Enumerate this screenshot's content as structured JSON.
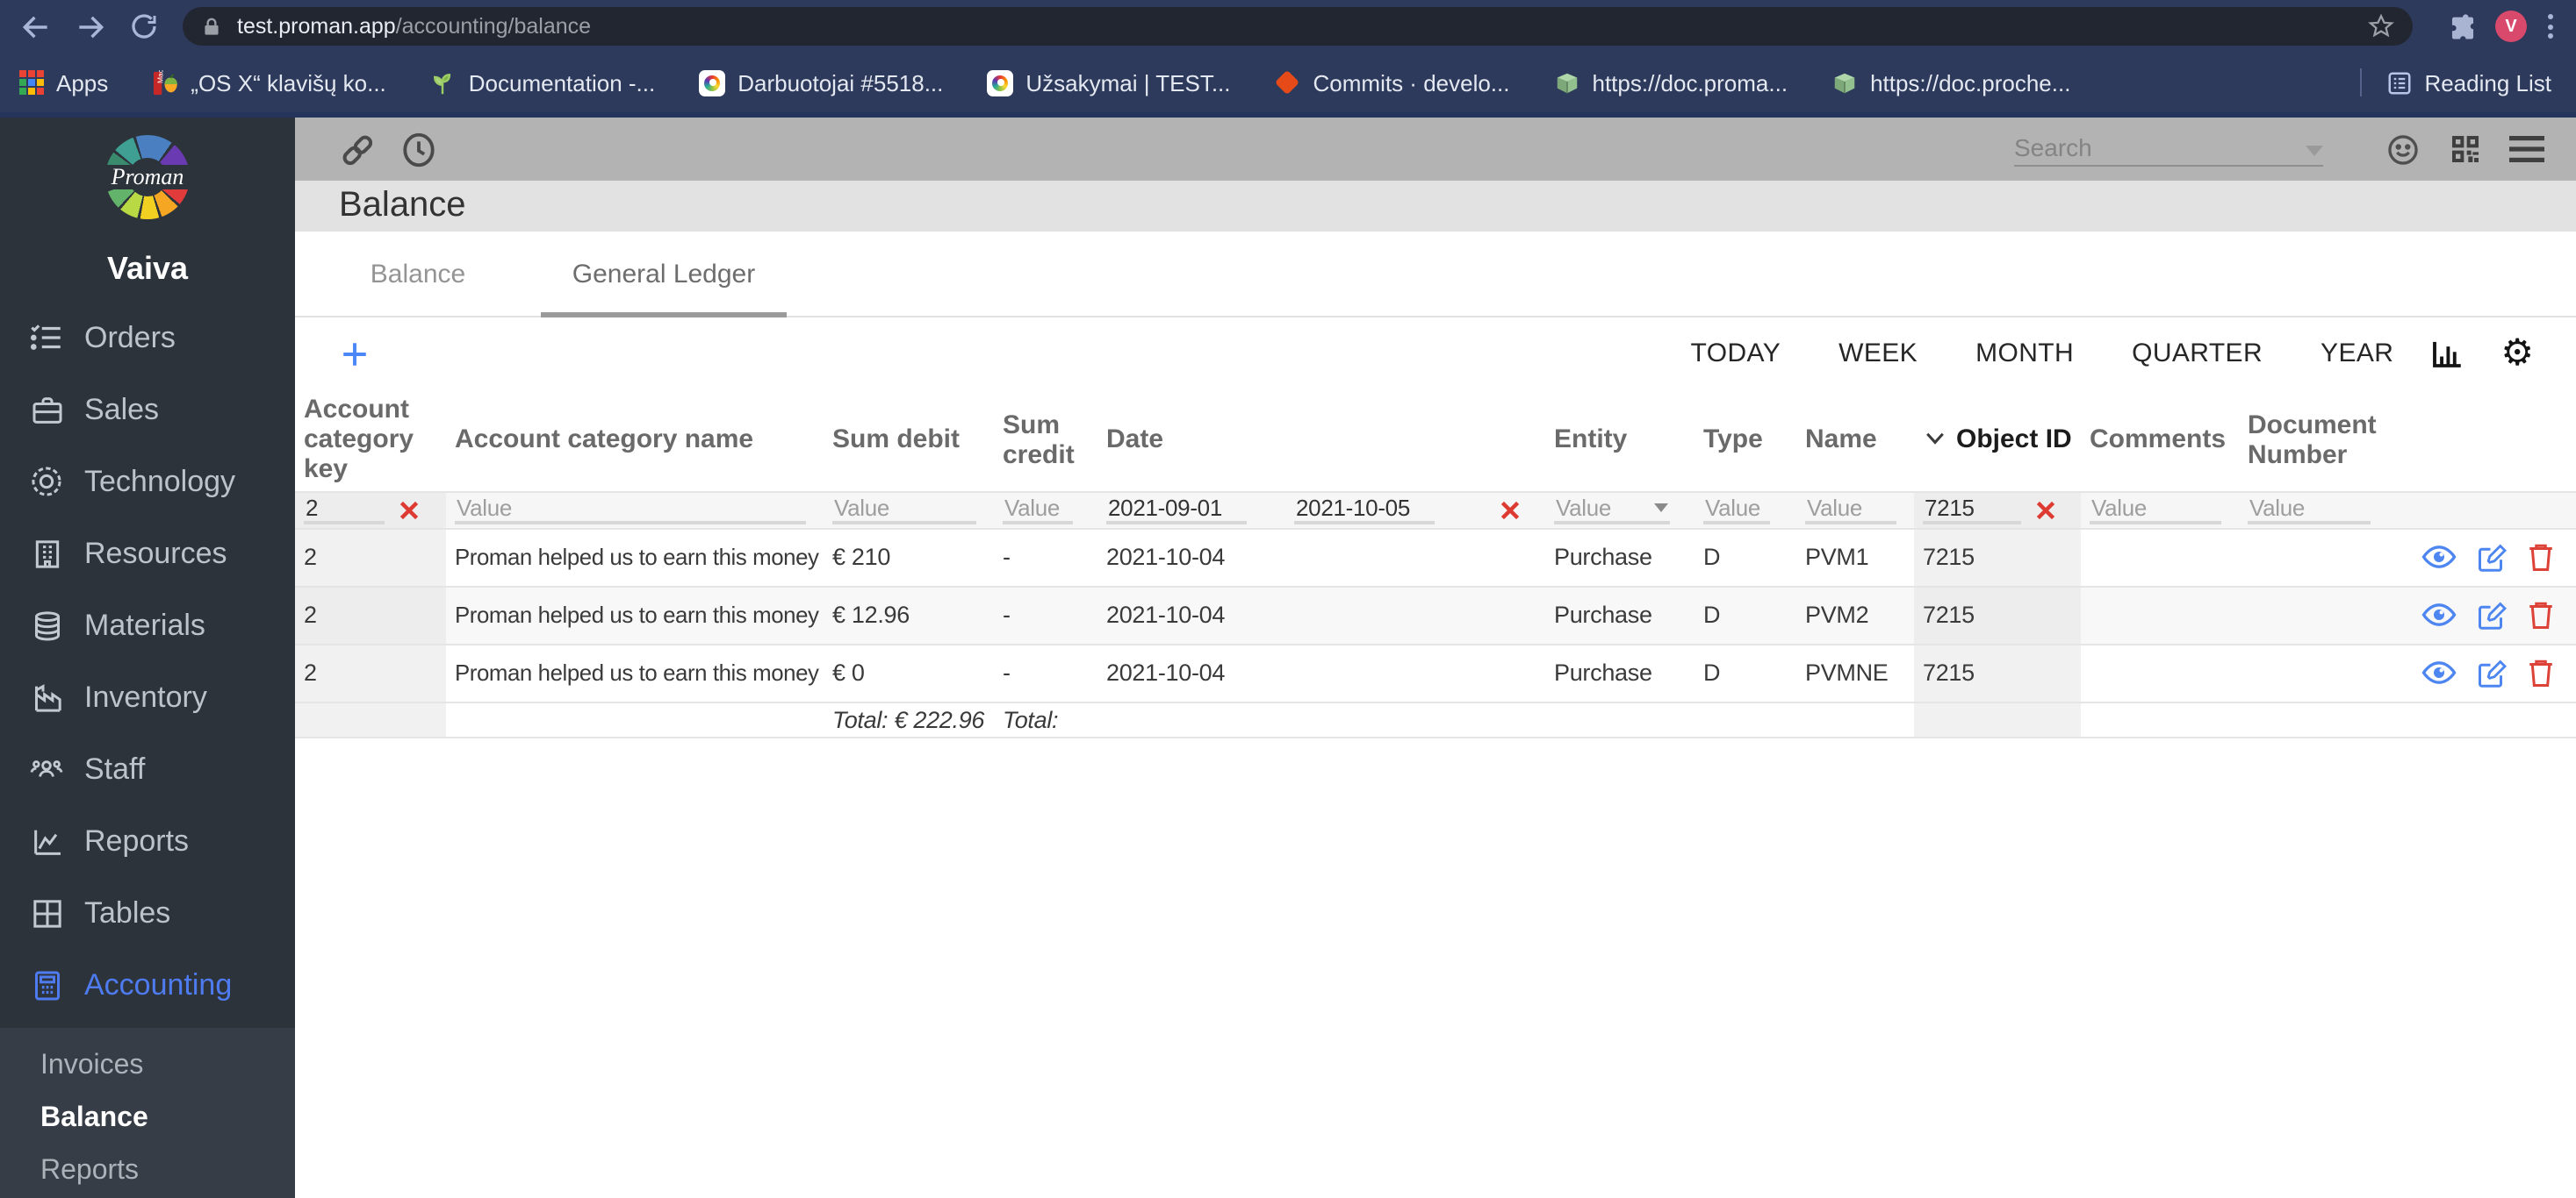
{
  "browser": {
    "url_host": "test.proman.app",
    "url_path": "/accounting/balance",
    "profile_initial": "V",
    "apps_label": "Apps",
    "reading_list_label": "Reading List",
    "bookmarks": [
      {
        "label": "„OS X“ klavišų ko...",
        "icon": "apple-mac-icon"
      },
      {
        "label": "Documentation -...",
        "icon": "plant-icon"
      },
      {
        "label": "Darbuotojai #5518...",
        "icon": "proman-icon"
      },
      {
        "label": "Užsakymai | TEST...",
        "icon": "proman-icon"
      },
      {
        "label": "Commits · develo...",
        "icon": "git-icon"
      },
      {
        "label": "https://doc.proma...",
        "icon": "book-icon"
      },
      {
        "label": "https://doc.proche...",
        "icon": "book-icon"
      }
    ]
  },
  "sidebar": {
    "logo_text": "Proman",
    "user_name": "Vaiva",
    "items": [
      {
        "label": "Orders",
        "icon": "orders-icon"
      },
      {
        "label": "Sales",
        "icon": "sales-icon"
      },
      {
        "label": "Technology",
        "icon": "technology-icon"
      },
      {
        "label": "Resources",
        "icon": "resources-icon"
      },
      {
        "label": "Materials",
        "icon": "materials-icon"
      },
      {
        "label": "Inventory",
        "icon": "inventory-icon"
      },
      {
        "label": "Staff",
        "icon": "staff-icon"
      },
      {
        "label": "Reports",
        "icon": "reports-icon"
      },
      {
        "label": "Tables",
        "icon": "tables-icon"
      },
      {
        "label": "Accounting",
        "icon": "accounting-icon",
        "active": true
      }
    ],
    "subitems": [
      {
        "label": "Invoices",
        "active": false
      },
      {
        "label": "Balance",
        "active": true
      },
      {
        "label": "Reports",
        "active": false
      }
    ]
  },
  "header": {
    "page_title": "Balance",
    "search_placeholder": "Search",
    "tabs": [
      {
        "label": "Balance",
        "active": false
      },
      {
        "label": "General Ledger",
        "active": true
      }
    ]
  },
  "toolbar": {
    "periods": [
      "TODAY",
      "WEEK",
      "MONTH",
      "QUARTER",
      "YEAR"
    ]
  },
  "table": {
    "columns": [
      {
        "key": "account_category_key",
        "label": "Account category key"
      },
      {
        "key": "account_category_name",
        "label": "Account category name"
      },
      {
        "key": "sum_debit",
        "label": "Sum debit"
      },
      {
        "key": "sum_credit",
        "label": "Sum credit"
      },
      {
        "key": "date",
        "label": "Date"
      },
      {
        "key": "entity",
        "label": "Entity"
      },
      {
        "key": "type",
        "label": "Type"
      },
      {
        "key": "name",
        "label": "Name"
      },
      {
        "key": "object_id",
        "label": "Object ID",
        "sorted": "desc"
      },
      {
        "key": "comments",
        "label": "Comments"
      },
      {
        "key": "document_number",
        "label": "Document Number"
      },
      {
        "key": "actions",
        "label": ""
      }
    ],
    "filters": {
      "account_category_key": {
        "value": "2",
        "clear": true
      },
      "account_category_name": {
        "placeholder": "Value"
      },
      "sum_debit": {
        "placeholder": "Value"
      },
      "sum_credit": {
        "placeholder": "Value"
      },
      "date": {
        "from": "2021-09-01",
        "to": "2021-10-05",
        "clear": true
      },
      "entity": {
        "placeholder": "Value",
        "dropdown": true
      },
      "type": {
        "placeholder": "Value"
      },
      "name": {
        "placeholder": "Value"
      },
      "object_id": {
        "value": "7215",
        "clear": true
      },
      "comments": {
        "placeholder": "Value"
      },
      "document_number": {
        "placeholder": "Value"
      }
    },
    "rows": [
      {
        "account_category_key": "2",
        "account_category_name": "Proman helped us to earn this money",
        "sum_debit": "€ 210",
        "sum_credit": "-",
        "date": "2021-10-04",
        "entity": "Purchase",
        "type": "D",
        "name": "PVM1",
        "object_id": "7215",
        "comments": "",
        "document_number": ""
      },
      {
        "account_category_key": "2",
        "account_category_name": "Proman helped us to earn this money",
        "sum_debit": "€ 12.96",
        "sum_credit": "-",
        "date": "2021-10-04",
        "entity": "Purchase",
        "type": "D",
        "name": "PVM2",
        "object_id": "7215",
        "comments": "",
        "document_number": ""
      },
      {
        "account_category_key": "2",
        "account_category_name": "Proman helped us to earn this money",
        "sum_debit": "€ 0",
        "sum_credit": "-",
        "date": "2021-10-04",
        "entity": "Purchase",
        "type": "D",
        "name": "PVMNE",
        "object_id": "7215",
        "comments": "",
        "document_number": ""
      }
    ],
    "totals": {
      "sum_debit": "Total: € 222.96",
      "sum_credit": "Total:"
    }
  },
  "colors": {
    "accent_blue": "#4e7cf0",
    "action_blue": "#4d86f0",
    "danger_red": "#dd4238",
    "chrome_navy": "#2d3a5c",
    "sidebar_dark": "#2d333b",
    "toolbar_gray": "#b3b3b3"
  }
}
